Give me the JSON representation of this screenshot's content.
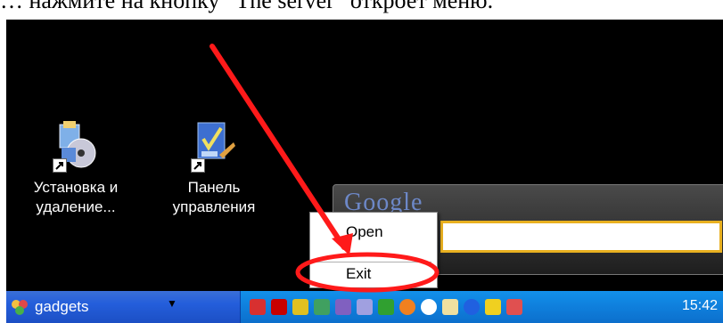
{
  "document": {
    "caption_fragment": "… нажмите на кнопку “The server” откроет меню."
  },
  "desktop": {
    "icons": [
      {
        "label": "Установка и\nудаление...",
        "icon": "add-remove-programs-icon"
      },
      {
        "label": "Панель\nуправления",
        "icon": "control-panel-icon"
      }
    ]
  },
  "gadget": {
    "logo": "Google",
    "search_value": ""
  },
  "context_menu": {
    "items": [
      {
        "label": "Open"
      },
      {
        "label": "Exit"
      }
    ]
  },
  "taskbar": {
    "button_label": "gadgets",
    "clock": "15:42"
  },
  "tray": {
    "icons": [
      "network-icon",
      "ati-icon",
      "display-icon",
      "printer-icon",
      "pen-icon",
      "speaker-icon",
      "media-player-icon",
      "swirl-icon",
      "panda-icon",
      "calendar-icon",
      "help-icon",
      "airplane-icon",
      "user-icon"
    ]
  },
  "annotation": {
    "arrow_color": "#ff1a1a",
    "ring_color": "#ff1a1a"
  }
}
